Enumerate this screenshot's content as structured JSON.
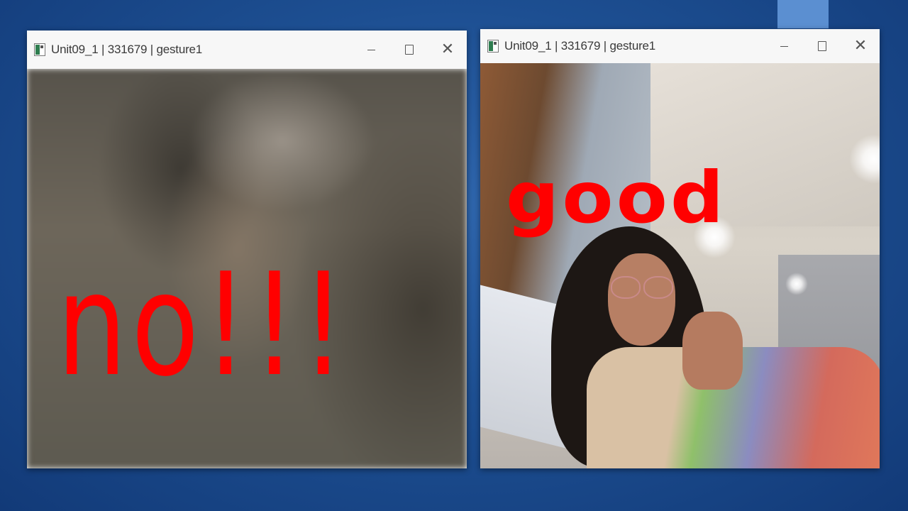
{
  "windows": [
    {
      "title": "Unit09_1 | 331679 | gesture1",
      "overlay_text": "no!!!",
      "controls": {
        "minimize": "minimize-icon",
        "maximize": "maximize-icon",
        "close": "close-icon"
      }
    },
    {
      "title": "Unit09_1 | 331679 | gesture1",
      "overlay_text": "good",
      "controls": {
        "minimize": "minimize-icon",
        "maximize": "maximize-icon",
        "close": "close-icon"
      }
    }
  ],
  "colors": {
    "background": "#1d4f92",
    "accent_block": "#5b8fd1",
    "overlay_text": "#ff0000",
    "titlebar": "#f7f7f7"
  }
}
